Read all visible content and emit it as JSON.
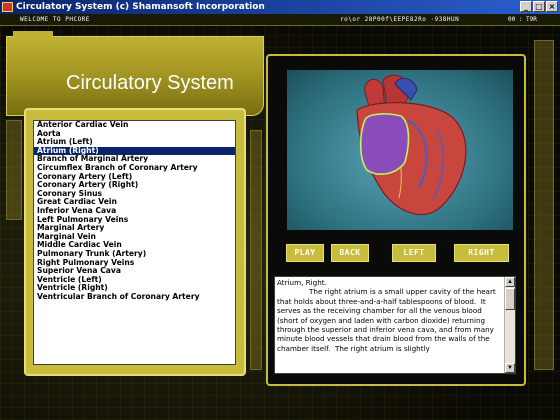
{
  "window": {
    "title": "Circulatory System (c) Shamansoft Incorporation",
    "buttons": [
      "_",
      "□",
      "×"
    ]
  },
  "hud": {
    "welcome": "WELCOME TO PHCORE",
    "code": "ro\\or 28P00f\\EEPE82Ro ·938HUN",
    "code_right": "00 : T9R"
  },
  "page_title": "Circulatory System",
  "structures": [
    "Anterior Cardiac Vein",
    "Aorta",
    "Atrium (Left)",
    "Atrium (Right)",
    "Branch of Marginal Artery",
    "Circumflex Branch of Coronary Artery",
    "Coronary Artery (Left)",
    "Coronary Artery (Right)",
    "Coronary Sinus",
    "Great Cardiac Vein",
    "Inferior Vena Cava",
    "Left Pulmonary Veins",
    "Marginal Artery",
    "Marginal Vein",
    "Middle Cardiac Vein",
    "Pulmonary Trunk (Artery)",
    "Right Pulmonary Veins",
    "Superior Vena Cava",
    "Ventricle (Left)",
    "Ventricle (Right)",
    "Ventricular Branch of Coronary Artery"
  ],
  "selected_index": 3,
  "controls": {
    "play": "PLAY",
    "back": "BACK",
    "left": "LEFT",
    "right": "RIGHT"
  },
  "description": "Atrium, Right.\n              The right atrium is a small upper cavity of the heart that holds about three-and-a-half tablespoons of blood.  It serves as the receiving chamber for all the venous blood (short of oxygen and laden with carbon dioxide) returning through the superior and inferior vena cava, and from many minute blood vessels that drain blood from the walls of the chamber itself.  The right atrium is slightly",
  "colors": {
    "accent": "#c8bc3c",
    "selection": "#0a246a"
  }
}
